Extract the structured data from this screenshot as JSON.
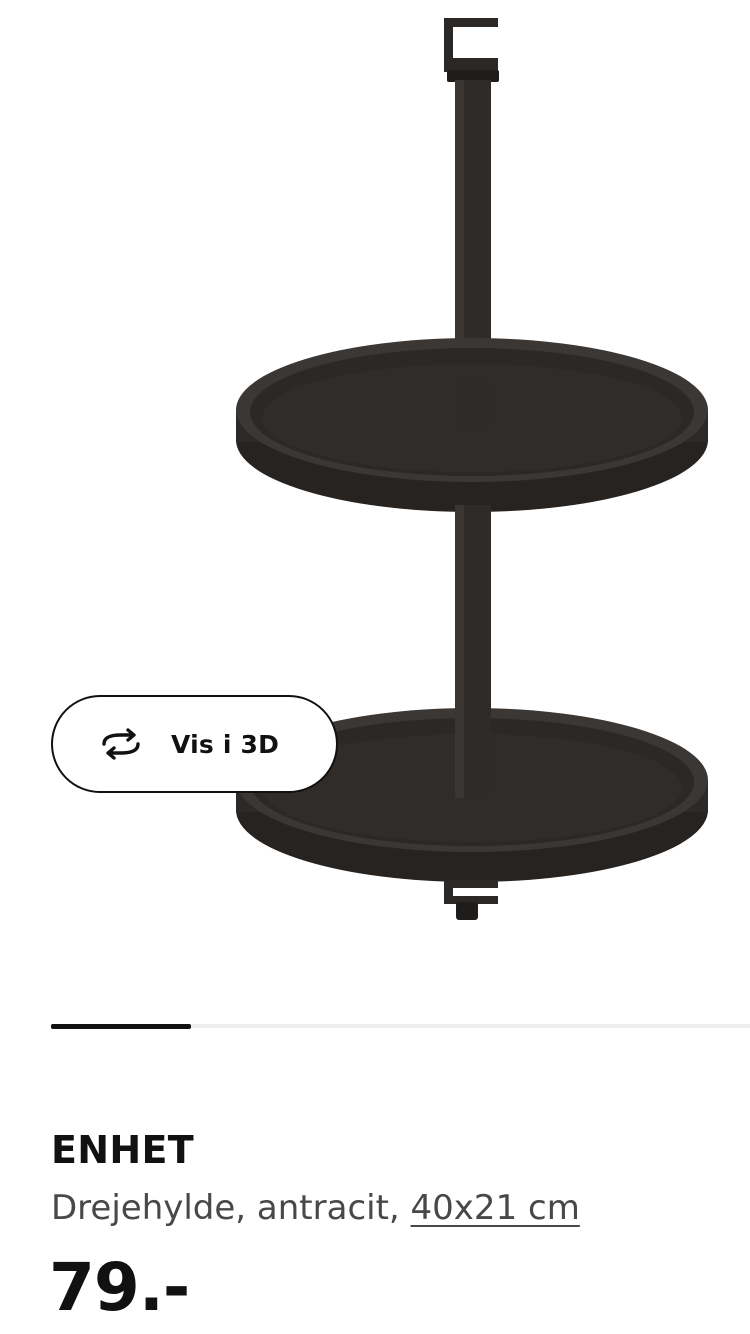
{
  "view_in_3d": {
    "label": "Vis i 3D",
    "icon": "rotate-3d-icon"
  },
  "carousel": {
    "progress": 0.2
  },
  "product": {
    "name": "ENHET",
    "description": "Drejehylde, antracit,",
    "dimensions": "40x21 cm",
    "price": "79.-"
  },
  "colors": {
    "product": "#2b2826",
    "text": "#111111",
    "secondary_text": "#484848"
  }
}
